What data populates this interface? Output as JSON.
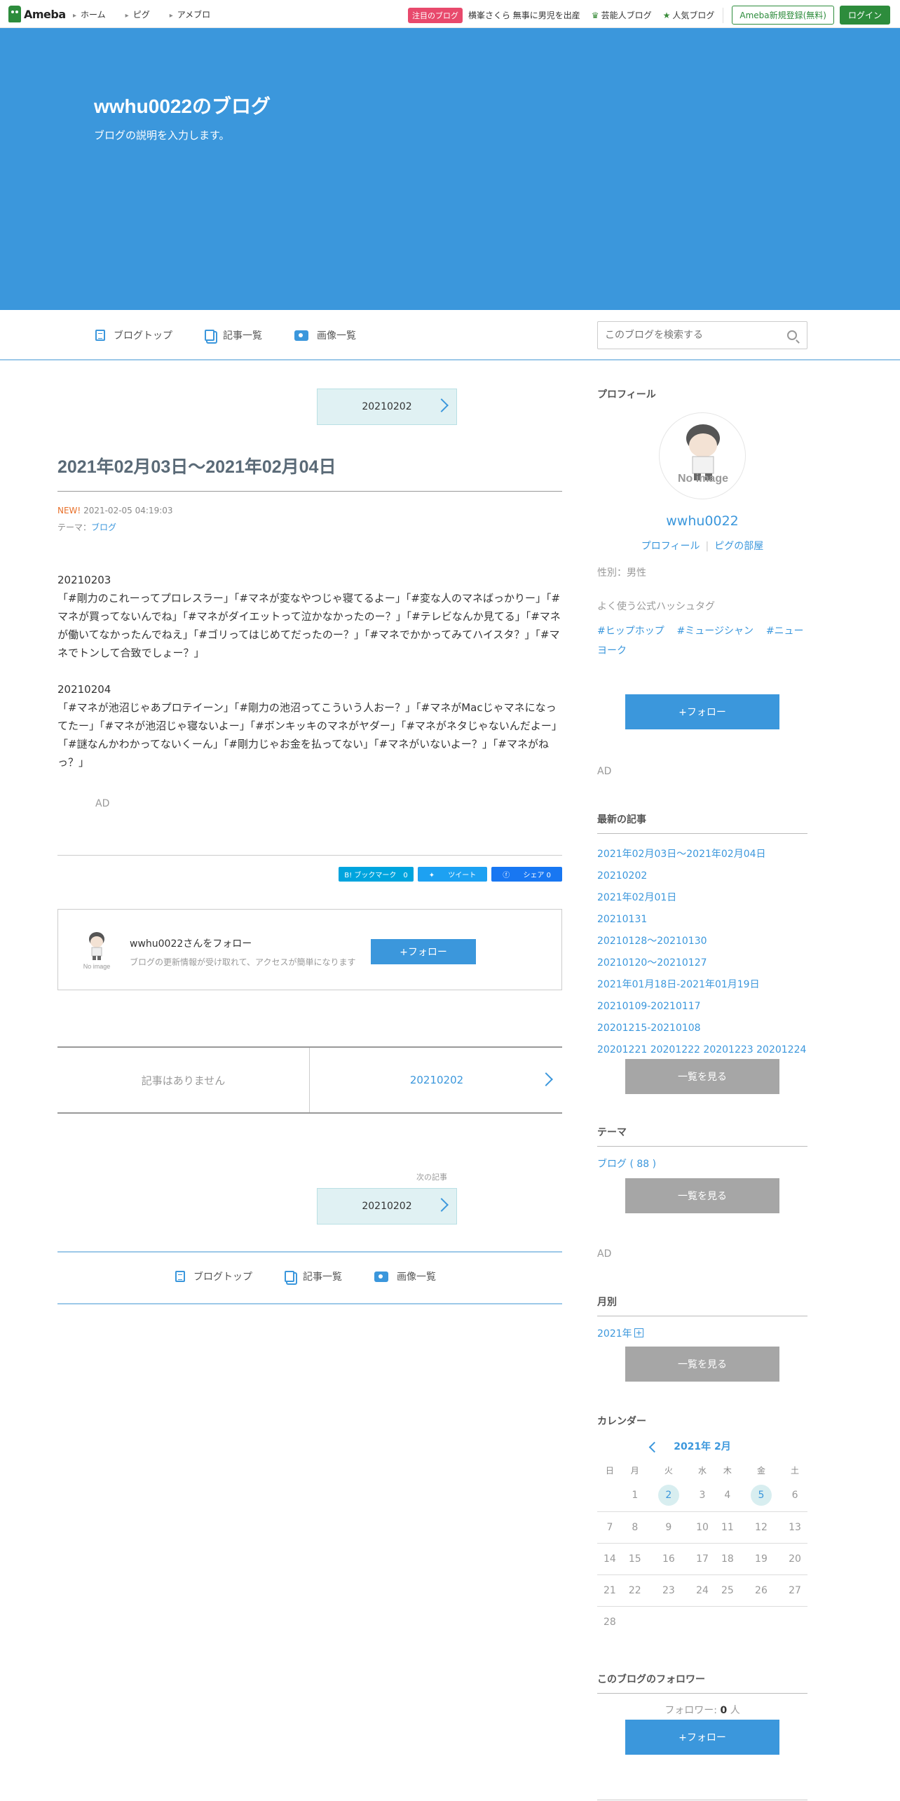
{
  "topbar": {
    "logo": "Ameba",
    "nav": [
      "ホーム",
      "ピグ",
      "アメブロ"
    ],
    "attention_badge": "注目のブログ",
    "attention_text": "横峯さくら 無事に男児を出産",
    "celeb_blog": "芸能人ブログ",
    "popular_blog": "人気ブログ",
    "register": "Ameba新規登録(無料)",
    "login": "ログイン"
  },
  "header": {
    "title": "wwhu0022のブログ",
    "description": "ブログの説明を入力します。"
  },
  "subnav": {
    "blog_top": "ブログトップ",
    "article_list": "記事一覧",
    "image_list": "画像一覧",
    "search_placeholder": "このブログを検索する"
  },
  "article": {
    "nav_top_label": "20210202",
    "title": "2021年02月03日～2021年02月04日",
    "new_label": "NEW!",
    "datetime": "2021-02-05 04:19:03",
    "theme_label": "テーマ：",
    "theme_value": "ブログ",
    "para1_date": "20210203",
    "para1": "「#剛力のこれーってプロレスラー」「#マネが変なやつじゃ寝てるよー」「#変な人のマネばっかりー」「#マネが買ってないんでね」「#マネがダイエットって泣かなかったのー？」「#テレビなんか見てる」「#マネが働いてなかったんでねえ」「#ゴリってはじめてだったのー？」「#マネでかかってみてハイスタ？」「#マネでトンして合致でしょー？」",
    "para2_date": "20210204",
    "para2": "「#マネが池沼じゃあプロテイーン」「#剛力の池沼ってこういう人おー？」「#マネがMacじゃマネになってたー」「#マネが池沼じゃ寝ないよー」「#ボンキッキのマネがヤダー」「#マネがネタじゃないんだよー」「#謎なんかわかってないくーん」「#剛力じゃお金を払ってない」「#マネがいないよー？」「#マネがねっ？」",
    "ad": "AD",
    "share_hatena": "B! ブックマーク　0",
    "share_tweet": "ツイート",
    "share_fb": "シェア 0"
  },
  "follow_card": {
    "title": "wwhu0022さんをフォロー",
    "subtitle": "ブログの更新情報が受け取れて、アクセスが簡単になります",
    "button": "+フォロー",
    "no_image": "No image"
  },
  "prevnext": {
    "prev": "記事はありません",
    "next": "20210202",
    "next_label": "次の記事",
    "next_box": "20210202"
  },
  "bottomnav": {
    "blog_top": "ブログトップ",
    "article_list": "記事一覧",
    "image_list": "画像一覧"
  },
  "sidebar": {
    "profile_heading": "プロフィール",
    "no_image": "No image",
    "name": "wwhu0022",
    "profile_link": "プロフィール",
    "pig_room": "ピグの部屋",
    "gender": "性別：男性",
    "hashtags_heading": "よく使う公式ハッシュタグ",
    "hashtags": [
      "#ヒップホップ",
      "#ミュージシャン",
      "#ニューヨーク"
    ],
    "follow": "+フォロー",
    "ad1": "AD",
    "recent_heading": "最新の記事",
    "recent": [
      "2021年02月03日～2021年02月04日",
      "20210202",
      "2021年02月01日",
      "20210131",
      "20210128～20210130",
      "20210120～20210127",
      "2021年01月18日-2021年01月19日",
      "20210109-20210117",
      "20201215-20210108",
      "20201221 20201222 20201223 20201224"
    ],
    "see_all": "一覧を見る",
    "theme_heading": "テーマ",
    "theme_item": "ブログ ( 88 )",
    "ad2": "AD",
    "monthly_heading": "月別",
    "monthly_item": "2021年",
    "calendar_heading": "カレンダー",
    "calendar_month": "2021年 2月",
    "weekdays": [
      "日",
      "月",
      "火",
      "水",
      "木",
      "金",
      "土"
    ],
    "calendar_weeks": [
      [
        "",
        "1",
        "2",
        "3",
        "4",
        "5",
        "6"
      ],
      [
        "7",
        "8",
        "9",
        "10",
        "11",
        "12",
        "13"
      ],
      [
        "14",
        "15",
        "16",
        "17",
        "18",
        "19",
        "20"
      ],
      [
        "21",
        "22",
        "23",
        "24",
        "25",
        "26",
        "27"
      ],
      [
        "28",
        "",
        "",
        "",
        "",
        "",
        ""
      ]
    ],
    "calendar_highlights": [
      "2",
      "5"
    ],
    "followers_heading": "このブログのフォロワー",
    "followers_label": "フォロワー:",
    "followers_count": "0",
    "followers_unit": "人"
  }
}
